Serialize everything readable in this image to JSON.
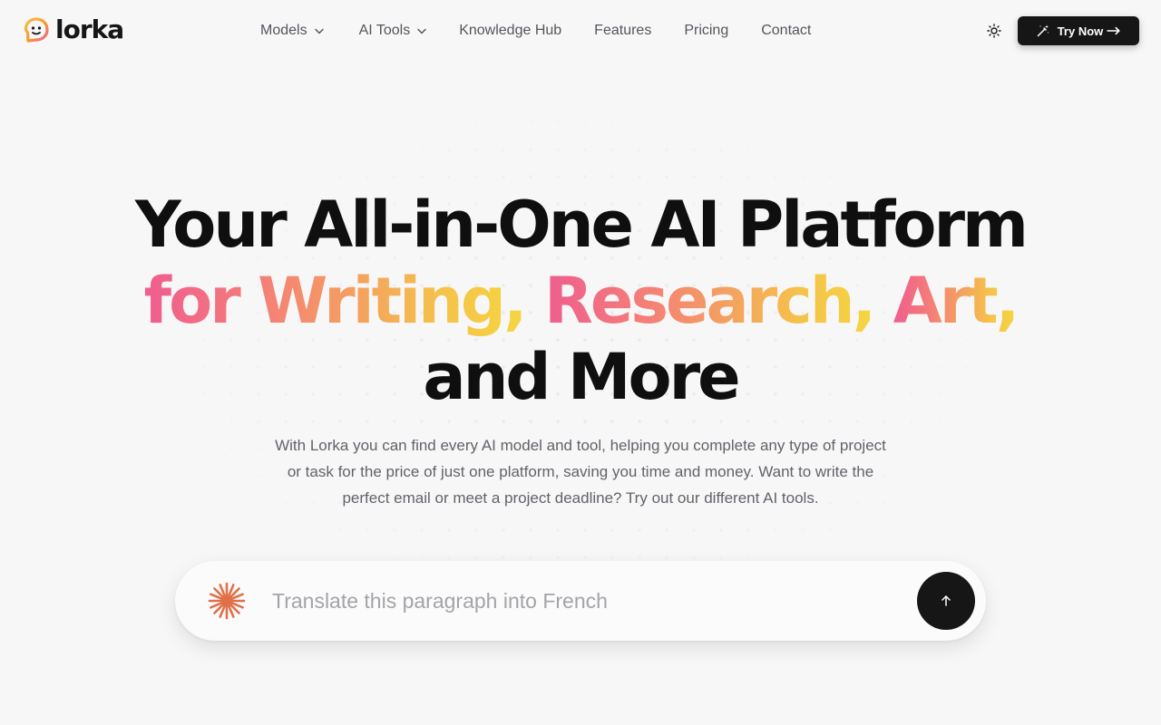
{
  "brand": {
    "name": "lorka"
  },
  "nav": {
    "items": [
      {
        "label": "Models",
        "has_dropdown": true
      },
      {
        "label": "AI Tools",
        "has_dropdown": true
      },
      {
        "label": "Knowledge Hub",
        "has_dropdown": false
      },
      {
        "label": "Features",
        "has_dropdown": false
      },
      {
        "label": "Pricing",
        "has_dropdown": false
      },
      {
        "label": "Contact",
        "has_dropdown": false
      }
    ],
    "theme_toggle_icon": "sun-icon",
    "cta_label": "Try Now",
    "cta_icon": "magic-wand-icon"
  },
  "hero": {
    "title_line1": "Your All-in-One AI Platform",
    "title_line2_parts": [
      "for Writing,",
      "Research,",
      "Art,"
    ],
    "title_line3": "and More",
    "description": "With Lorka you can find every AI model and tool, helping you complete any type of project or task for the price of just one platform, saving you time and money. Want to write the perfect email or meet a project deadline? Try out our different AI tools."
  },
  "prompt": {
    "placeholder": "Translate this paragraph into French",
    "value": "",
    "leading_icon": "sparkle-burst-icon",
    "send_icon": "arrow-up-icon"
  },
  "colors": {
    "primary": "#161616",
    "gradient_start": "#ef5d8f",
    "gradient_mid": "#f4a060",
    "gradient_end": "#f5d640",
    "logo_accent": "#f59e2a"
  }
}
